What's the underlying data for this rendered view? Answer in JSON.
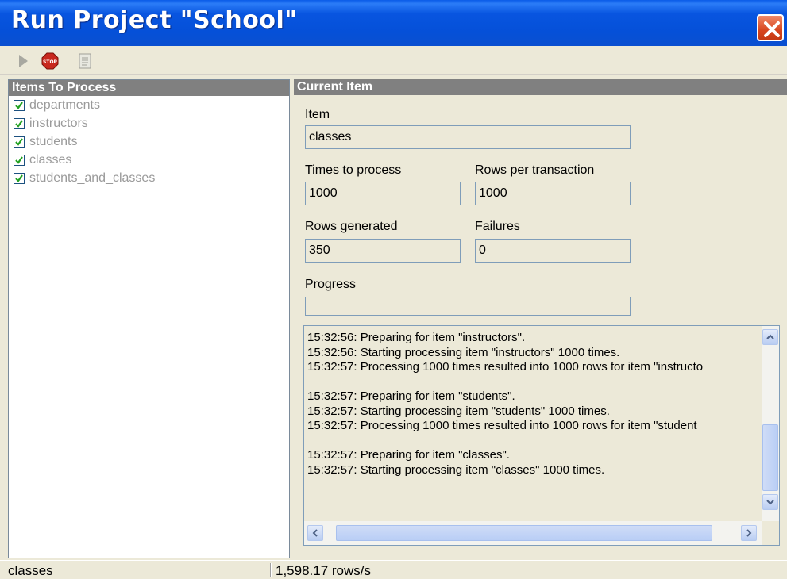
{
  "window": {
    "title": "Run Project \"School\""
  },
  "toolbar": {
    "run_icon": "play-icon",
    "stop_icon": "stop-sign-icon",
    "stop_label": "STOP",
    "log_icon": "log-icon"
  },
  "items_panel": {
    "header": "Items To Process",
    "items": [
      {
        "label": "departments",
        "checked": true
      },
      {
        "label": "instructors",
        "checked": true
      },
      {
        "label": "students",
        "checked": true
      },
      {
        "label": "classes",
        "checked": true
      },
      {
        "label": "students_and_classes",
        "checked": true
      }
    ]
  },
  "current_item": {
    "header": "Current Item",
    "item_label": "Item",
    "item_value": "classes",
    "times_label": "Times to process",
    "times_value": "1000",
    "rows_per_tx_label": "Rows per transaction",
    "rows_per_tx_value": "1000",
    "rows_generated_label": "Rows generated",
    "rows_generated_value": "350",
    "failures_label": "Failures",
    "failures_value": "0",
    "progress_label": "Progress",
    "progress_value": 0
  },
  "log": {
    "lines": [
      "15:32:56: Preparing for item \"instructors\".",
      "15:32:56: Starting processing item \"instructors\" 1000 times.",
      "15:32:57: Processing 1000 times resulted into 1000 rows for item \"instructo",
      "",
      "15:32:57: Preparing for item \"students\".",
      "15:32:57: Starting processing item \"students\" 1000 times.",
      "15:32:57: Processing 1000 times resulted into 1000 rows for item \"student",
      "",
      "15:32:57: Preparing for item \"classes\".",
      "15:32:57: Starting processing item \"classes\" 1000 times."
    ]
  },
  "statusbar": {
    "item": "classes",
    "rate": "1,598.17 rows/s"
  },
  "colors": {
    "titlebar": "#0855e0",
    "panel_header": "#808080",
    "close_button": "#d8461f"
  }
}
